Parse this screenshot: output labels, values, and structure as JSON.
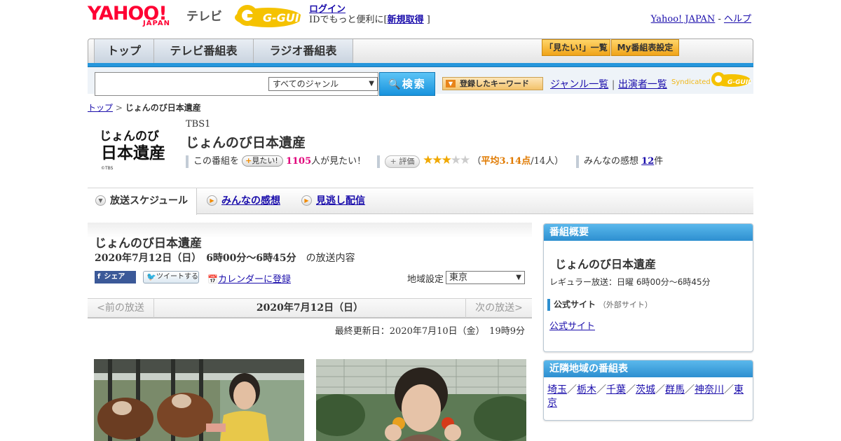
{
  "header": {
    "yahoo_logo": "YAHOO! JAPAN",
    "yahoo_logo_main": "YAHOO!",
    "yahoo_logo_sub": "JAPAN",
    "tv_label": "テレビ",
    "gguide_logo": "G-GUIDE",
    "login_label": "ログイン",
    "id_text_prefix": "IDでもっと便利に[",
    "signup_label": "新規取得",
    "id_text_suffix": "]",
    "yahoo_japan_link": "Yahoo! JAPAN",
    "separator": "-",
    "help_link": "ヘルプ"
  },
  "nav": {
    "tabs": [
      {
        "label": "トップ"
      },
      {
        "label": "テレビ番組表"
      },
      {
        "label": "ラジオ番組表"
      }
    ],
    "watchlist_button": "「見たい!」一覧",
    "my_schedule_button": "My番組表設定"
  },
  "search": {
    "placeholder": "",
    "genre_selected": "すべてのジャンル",
    "search_button": "検索",
    "keyword_button": "登録したキーワード",
    "genre_list_link": "ジャンル一覧",
    "link_separator": "|",
    "performer_list_link": "出演者一覧",
    "syndicated_label": "Syndicated"
  },
  "breadcrumb": {
    "home": "トップ",
    "separator": ">",
    "current": "じょんのび日本遺産"
  },
  "program": {
    "logo_text": "じょんのび日本遺産",
    "logo_copyright": "©TBS",
    "channel": "TBS1",
    "title": "じょんのび日本遺産",
    "want_prefix": "この番組を",
    "want_button": "見たい!",
    "want_count": "1105",
    "want_suffix": "人が見たい！",
    "eval_button": "評価",
    "rating": 3.14,
    "rating_open": "（",
    "rating_avg_label": "平均3.14点",
    "rating_count": "/14人）",
    "impressions_prefix": "みんなの感想",
    "impressions_count": "12",
    "impressions_suffix": "件"
  },
  "subtabs": {
    "schedule": "放送スケジュール",
    "impressions": "みんなの感想",
    "streaming": "見逃し配信"
  },
  "broadcast": {
    "title": "じょんのび日本遺産",
    "date_time": "2020年7月12日（日）　6時00分～6時45分",
    "date_suffix": "の放送内容",
    "share_button": "シェア",
    "tweet_button": "ツイートする",
    "calendar_link": "カレンダーに登録",
    "region_label": "地域設定",
    "region_selected": "東京",
    "prev_label": "<前の放送",
    "current_date": "2020年7月12日（日）",
    "next_label": "次の放送>",
    "last_updated": "最終更新日：2020年7月10日（金）　19時9分"
  },
  "sidebar": {
    "overview_header": "番組概要",
    "overview_title": "じょんのび日本遺産",
    "regular_broadcast": "レギュラー放送：日曜 6時00分～6時45分",
    "official_label": "公式サイト",
    "external_note": "（外部サイト）",
    "official_link": "公式サイト",
    "nearby_header": "近隣地域の番組表",
    "nearby_regions": [
      "埼玉",
      "栃木",
      "千葉",
      "茨城",
      "群馬",
      "神奈川",
      "東京"
    ],
    "region_separator": "／"
  },
  "colors": {
    "yahoo_red": "#ff0033",
    "nav_blue": "#2596dc",
    "link_blue": "#1a0dab",
    "orange_button": "#f0a318",
    "pink_count": "#e0007a",
    "star": "#f0a800"
  }
}
